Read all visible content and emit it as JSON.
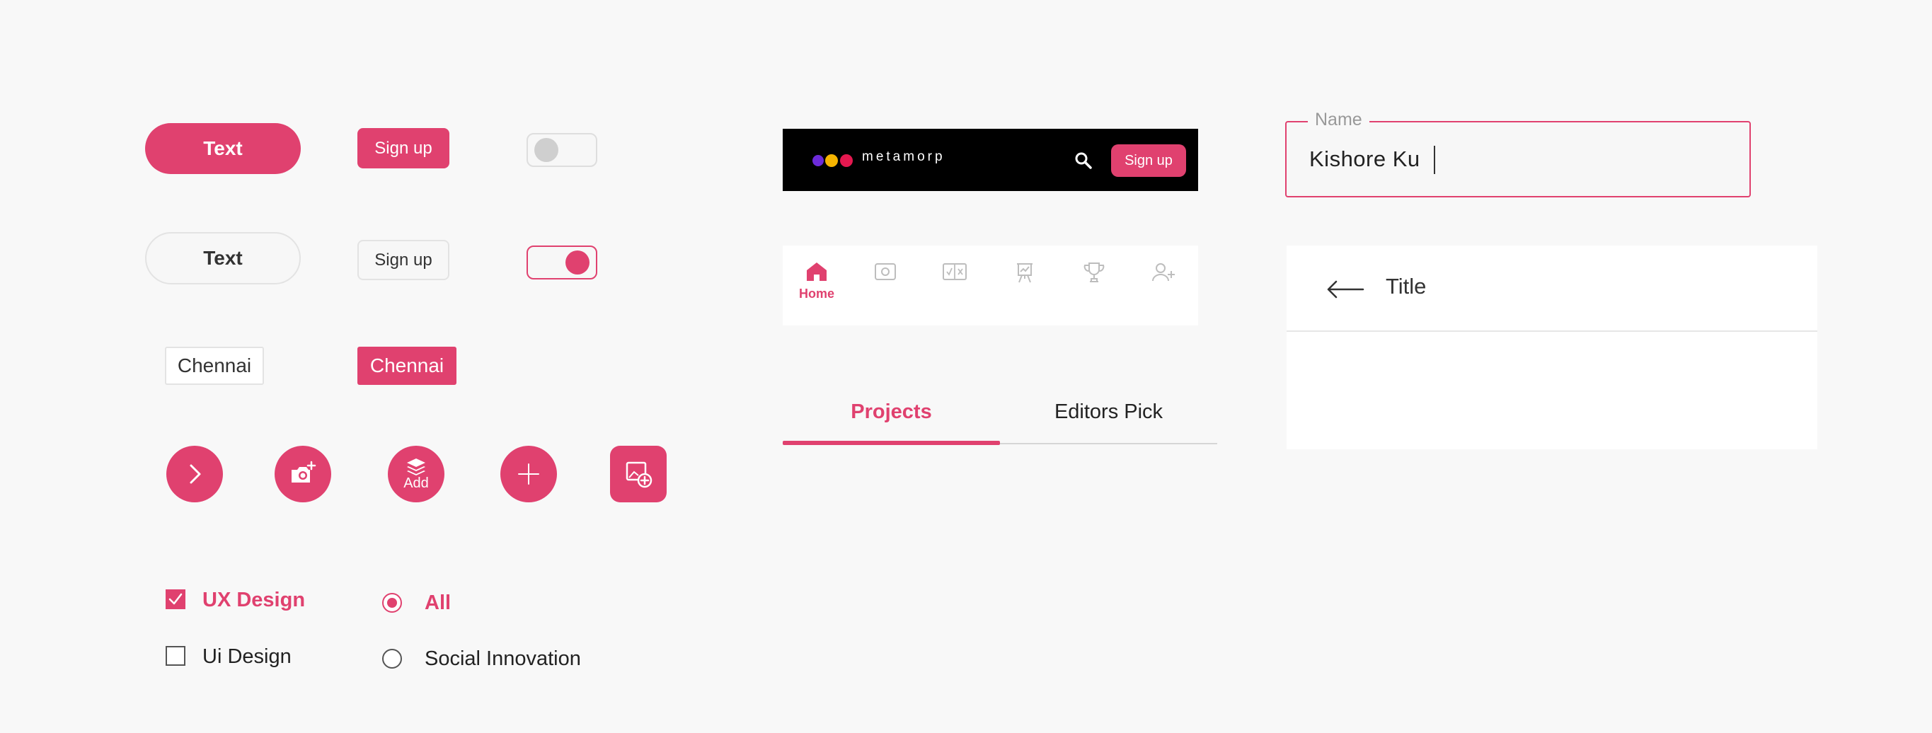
{
  "buttons": {
    "pill_filled": "Text",
    "pill_outline": "Text",
    "signup_filled": "Sign up",
    "signup_outline": "Sign up"
  },
  "toggles": {
    "first": "off",
    "second": "on"
  },
  "chips": {
    "outline": "Chennai",
    "filled": "Chennai"
  },
  "fabs": {
    "next_icon": "chevron-right-icon",
    "camera_icon": "camera-add-icon",
    "add_label": "Add",
    "plus_icon": "plus-icon",
    "add_image_icon": "add-image-icon"
  },
  "checkboxes": [
    {
      "label": "UX Design",
      "checked": true
    },
    {
      "label": "Ui Design",
      "checked": false
    }
  ],
  "radios": [
    {
      "label": "All",
      "selected": true
    },
    {
      "label": "Social Innovation",
      "selected": false
    }
  ],
  "header": {
    "logo_text": "metamorp",
    "search_icon": "search-icon",
    "signup_label": "Sign up"
  },
  "bottom_nav": {
    "home_label": "Home",
    "items": [
      "home-icon",
      "photo-icon",
      "compare-icon",
      "presentation-icon",
      "trophy-icon",
      "user-add-icon"
    ]
  },
  "tabs": [
    {
      "label": "Projects",
      "active": true
    },
    {
      "label": "Editors Pick",
      "active": false
    }
  ],
  "text_field": {
    "label": "Name",
    "value": "Kishore Ku"
  },
  "app_bar": {
    "back_icon": "arrow-left-icon",
    "title": "Title"
  },
  "colors": {
    "accent": "#e0416f",
    "logo_purple": "#6c2bd9",
    "logo_yellow": "#f5b400",
    "logo_red": "#e4184f"
  }
}
